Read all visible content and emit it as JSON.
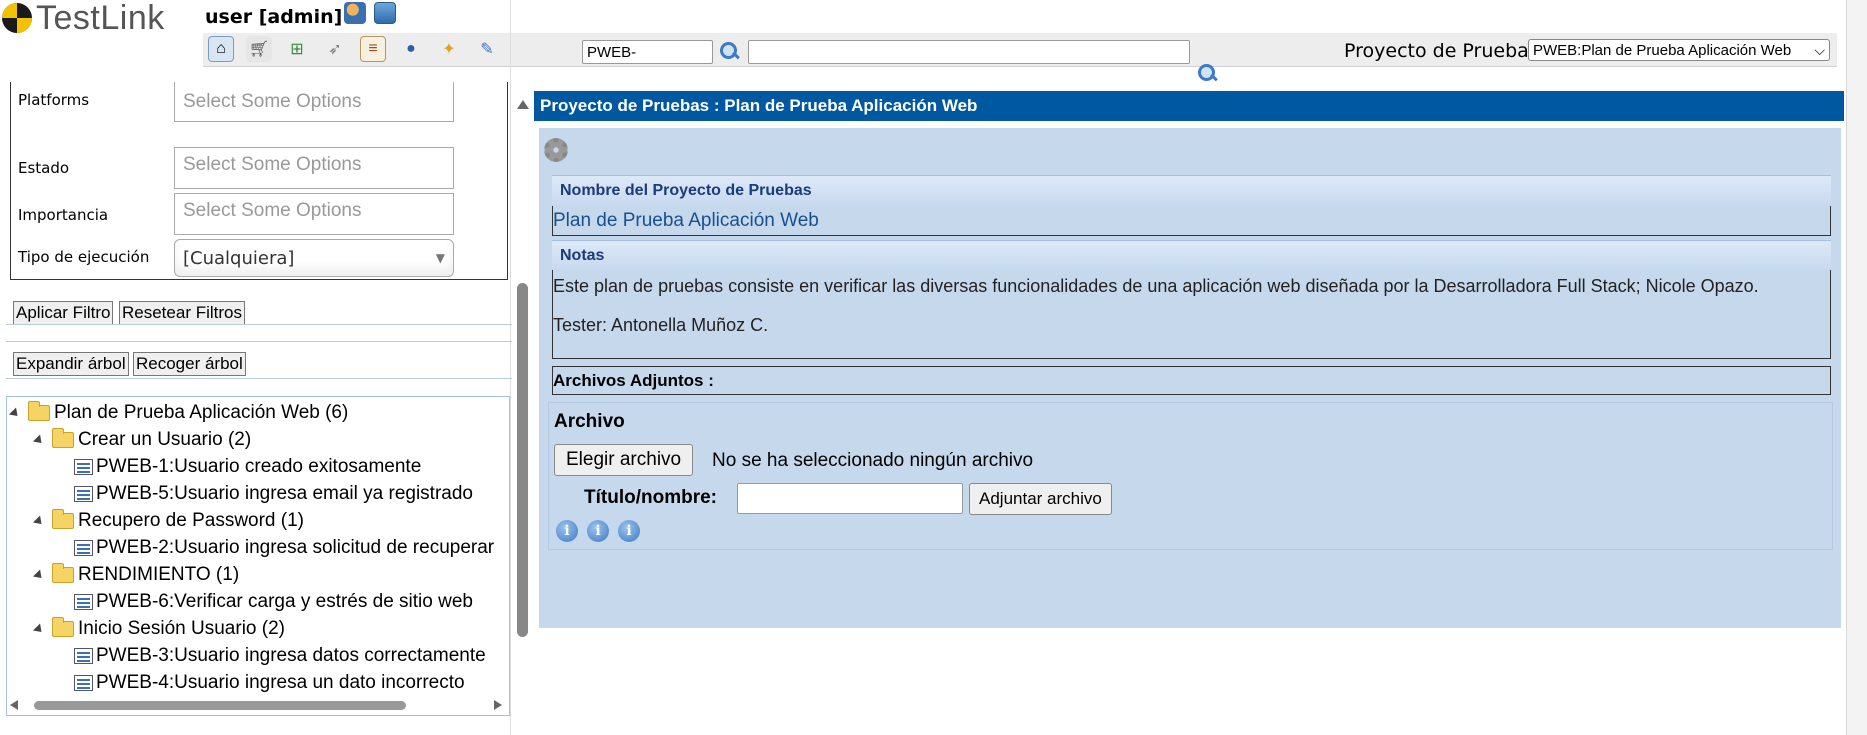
{
  "header": {
    "logo_text": "TestLink",
    "user_label": "user [admin]",
    "tc_id_value": "PWEB-",
    "search_value": "",
    "project_label": "Proyecto de Pruebas",
    "project_selected": "PWEB:Plan de Prueba Aplicación Web",
    "toolbar_icons": [
      "home-icon",
      "cart-icon",
      "tree-icon",
      "rocket-icon",
      "document-icon",
      "user-icon",
      "broom-icon",
      "pen-icon"
    ],
    "user_icons": [
      "edit-profile-icon",
      "logout-icon"
    ]
  },
  "filters": {
    "platforms_label": "Platforms",
    "platforms_placeholder": "Select Some Options",
    "estado_label": "Estado",
    "estado_placeholder": "Select Some Options",
    "importancia_label": "Importancia",
    "importancia_placeholder": "Select Some Options",
    "tipo_label": "Tipo de ejecución",
    "tipo_value": "[Cualquiera]",
    "apply_label": "Aplicar Filtro",
    "reset_label": "Resetear Filtros",
    "expand_label": "Expandir árbol",
    "collapse_label": "Recoger árbol"
  },
  "tree": {
    "root": "Plan de Prueba Aplicación Web (6)",
    "suites": [
      {
        "label": "Crear un Usuario (2)",
        "cases": [
          "PWEB-1:Usuario creado exitosamente",
          "PWEB-5:Usuario ingresa email ya registrado"
        ]
      },
      {
        "label": "Recupero de Password (1)",
        "cases": [
          "PWEB-2:Usuario ingresa solicitud de recuperar"
        ]
      },
      {
        "label": "RENDIMIENTO (1)",
        "cases": [
          "PWEB-6:Verificar carga y estrés de sitio web"
        ]
      },
      {
        "label": "Inicio Sesión Usuario (2)",
        "cases": [
          "PWEB-3:Usuario ingresa datos correctamente",
          "PWEB-4:Usuario ingresa un dato incorrecto"
        ]
      }
    ]
  },
  "main": {
    "title": "Proyecto de Pruebas : Plan de Prueba Aplicación Web",
    "name_header": "Nombre del Proyecto de Pruebas",
    "name_value": "Plan de Prueba Aplicación Web",
    "notes_header": "Notas",
    "notes_line1": "Este plan de pruebas consiste en verificar las diversas funcionalidades de una aplicación web diseñada por la Desarrolladora Full Stack; Nicole Opazo.",
    "notes_line2": "Tester: Antonella Muñoz C.",
    "attachments_label": "Archivos Adjuntos :",
    "file_label": "Archivo",
    "choose_button": "Elegir archivo",
    "no_file_text": "No se ha seleccionado ningún archivo",
    "title_label": "Título/nombre:",
    "title_input_value": "",
    "attach_button": "Adjuntar archivo",
    "info_glyph": "i"
  },
  "colors": {
    "title_bar": "#0058a0",
    "panel": "#c6d9ec",
    "link": "#1a4f8f"
  }
}
